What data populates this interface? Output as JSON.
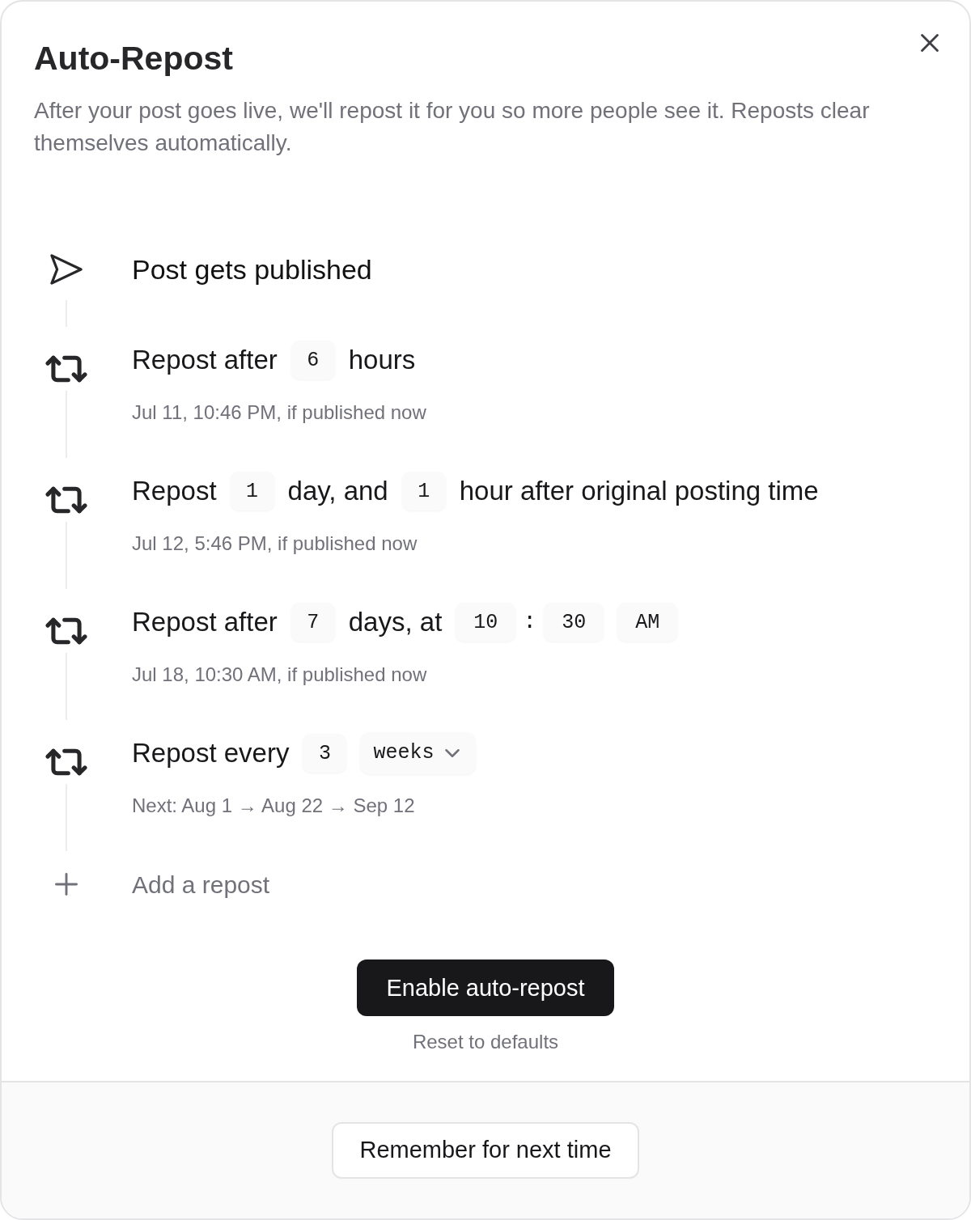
{
  "dialog": {
    "title": "Auto-Repost",
    "description": "After your post goes live, we'll repost it for you so more people see it. Reposts clear themselves automatically."
  },
  "timeline": [
    {
      "kind": "published",
      "parts": [
        {
          "kind": "text",
          "text": "Post gets published"
        }
      ]
    },
    {
      "kind": "repost",
      "parts": [
        {
          "kind": "text",
          "text": "Repost after"
        },
        {
          "kind": "field",
          "value": "6"
        },
        {
          "kind": "text",
          "text": "hours"
        }
      ],
      "note": "Jul 11, 10:46 PM, if published now"
    },
    {
      "kind": "repost",
      "parts": [
        {
          "kind": "text",
          "text": "Repost"
        },
        {
          "kind": "field",
          "value": "1"
        },
        {
          "kind": "text",
          "text": "day, and"
        },
        {
          "kind": "field",
          "value": "1"
        },
        {
          "kind": "text",
          "text": "hour after original posting time"
        }
      ],
      "note": "Jul 12, 5:46 PM, if published now"
    },
    {
      "kind": "repost",
      "parts": [
        {
          "kind": "text",
          "text": "Repost after"
        },
        {
          "kind": "field",
          "value": "7"
        },
        {
          "kind": "text",
          "text": "days, at"
        },
        {
          "kind": "field",
          "value": "10"
        },
        {
          "kind": "separator",
          "text": ":"
        },
        {
          "kind": "field",
          "value": "30"
        },
        {
          "kind": "field",
          "value": "AM"
        }
      ],
      "note": "Jul 18, 10:30 AM, if published now"
    },
    {
      "kind": "repost",
      "parts": [
        {
          "kind": "text",
          "text": "Repost every"
        },
        {
          "kind": "field",
          "value": "3"
        },
        {
          "kind": "select",
          "value": "weeks"
        }
      ],
      "note": "Next: Aug 1 → Aug 22 → Sep 12"
    },
    {
      "kind": "add",
      "label": "Add a repost"
    }
  ],
  "actions": {
    "primary": "Enable auto-repost",
    "reset": "Reset to defaults"
  },
  "footer": {
    "button": "Remember for next time"
  }
}
